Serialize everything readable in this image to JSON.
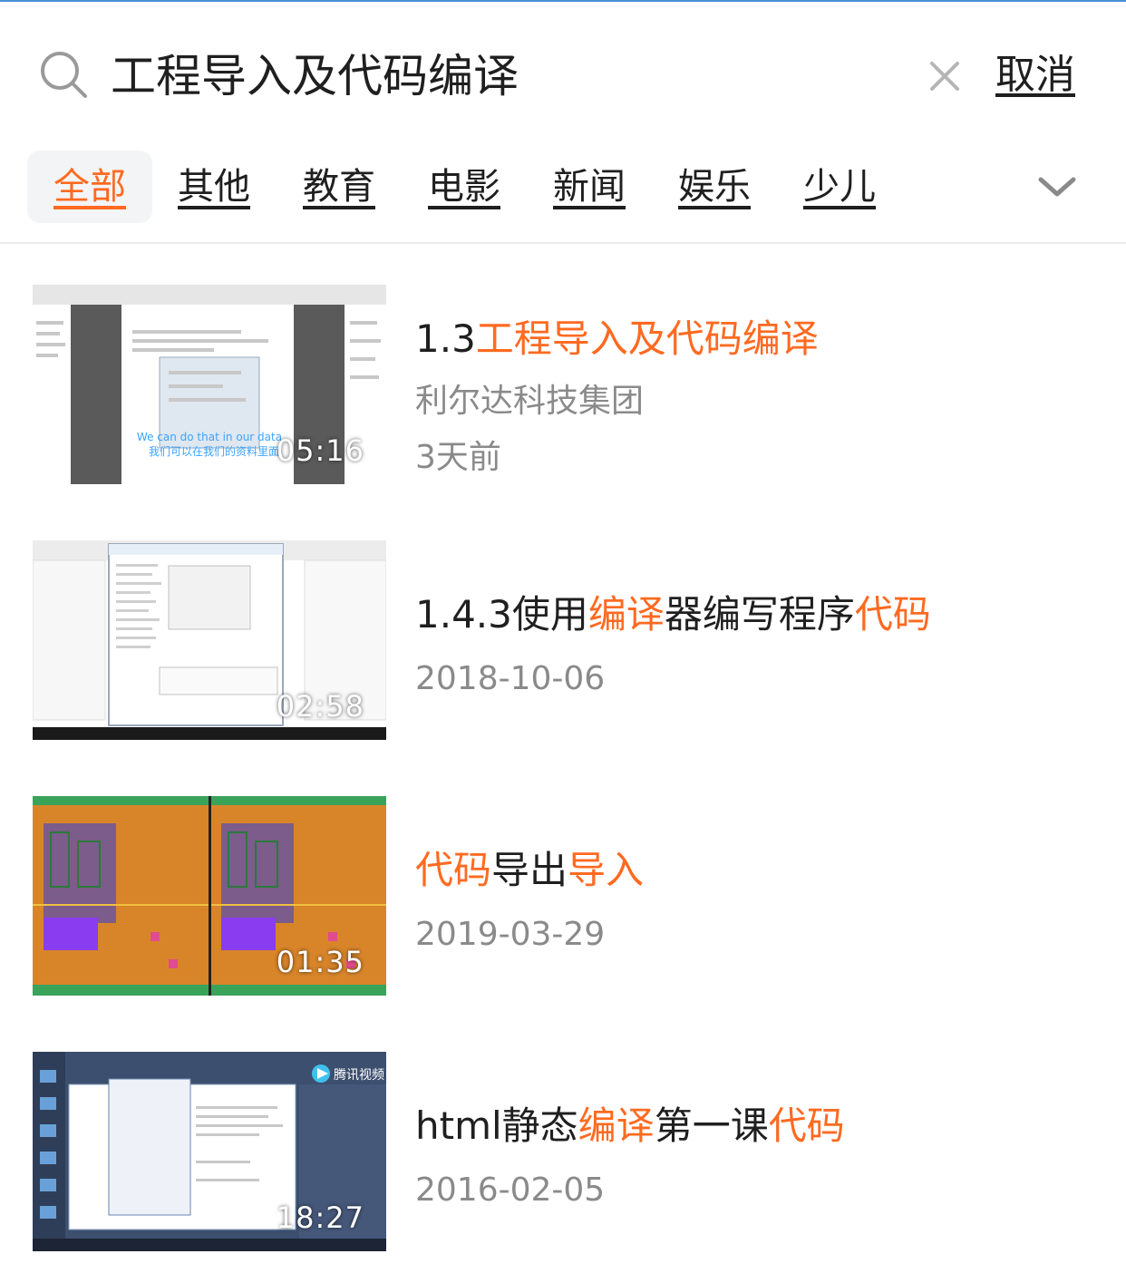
{
  "search": {
    "query": "工程导入及代码编译",
    "cancel_label": "取消"
  },
  "tabs": [
    {
      "label": "全部",
      "active": true
    },
    {
      "label": "其他",
      "active": false
    },
    {
      "label": "教育",
      "active": false
    },
    {
      "label": "电影",
      "active": false
    },
    {
      "label": "新闻",
      "active": false
    },
    {
      "label": "娱乐",
      "active": false
    },
    {
      "label": "少儿",
      "active": false
    }
  ],
  "colors": {
    "highlight": "#ff6a21",
    "text": "#1f1f1f",
    "muted": "#8a8a8a"
  },
  "results": [
    {
      "title_parts": [
        {
          "text": "1.3",
          "hl": false
        },
        {
          "text": "工程导入及代码编译",
          "hl": true
        }
      ],
      "meta": [
        "利尔达科技集团",
        "3天前"
      ],
      "duration": "05:16",
      "thumb_caption": [
        "We can do that in our data",
        "我们可以在我们的资料里面"
      ]
    },
    {
      "title_parts": [
        {
          "text": "1.4.3使用",
          "hl": false
        },
        {
          "text": "编译",
          "hl": true
        },
        {
          "text": "器编写程序",
          "hl": false
        },
        {
          "text": "代码",
          "hl": true
        }
      ],
      "meta": [
        "2018-10-06"
      ],
      "duration": "02:58"
    },
    {
      "title_parts": [
        {
          "text": "代码",
          "hl": true
        },
        {
          "text": "导出",
          "hl": false
        },
        {
          "text": "导入",
          "hl": true
        }
      ],
      "meta": [
        "2019-03-29"
      ],
      "duration": "01:35"
    },
    {
      "title_parts": [
        {
          "text": "html静态",
          "hl": false
        },
        {
          "text": "编译",
          "hl": true
        },
        {
          "text": "第一课",
          "hl": false
        },
        {
          "text": "代码",
          "hl": true
        }
      ],
      "meta": [
        "2016-02-05"
      ],
      "duration": "18:27",
      "watermark": "腾讯视频"
    }
  ]
}
